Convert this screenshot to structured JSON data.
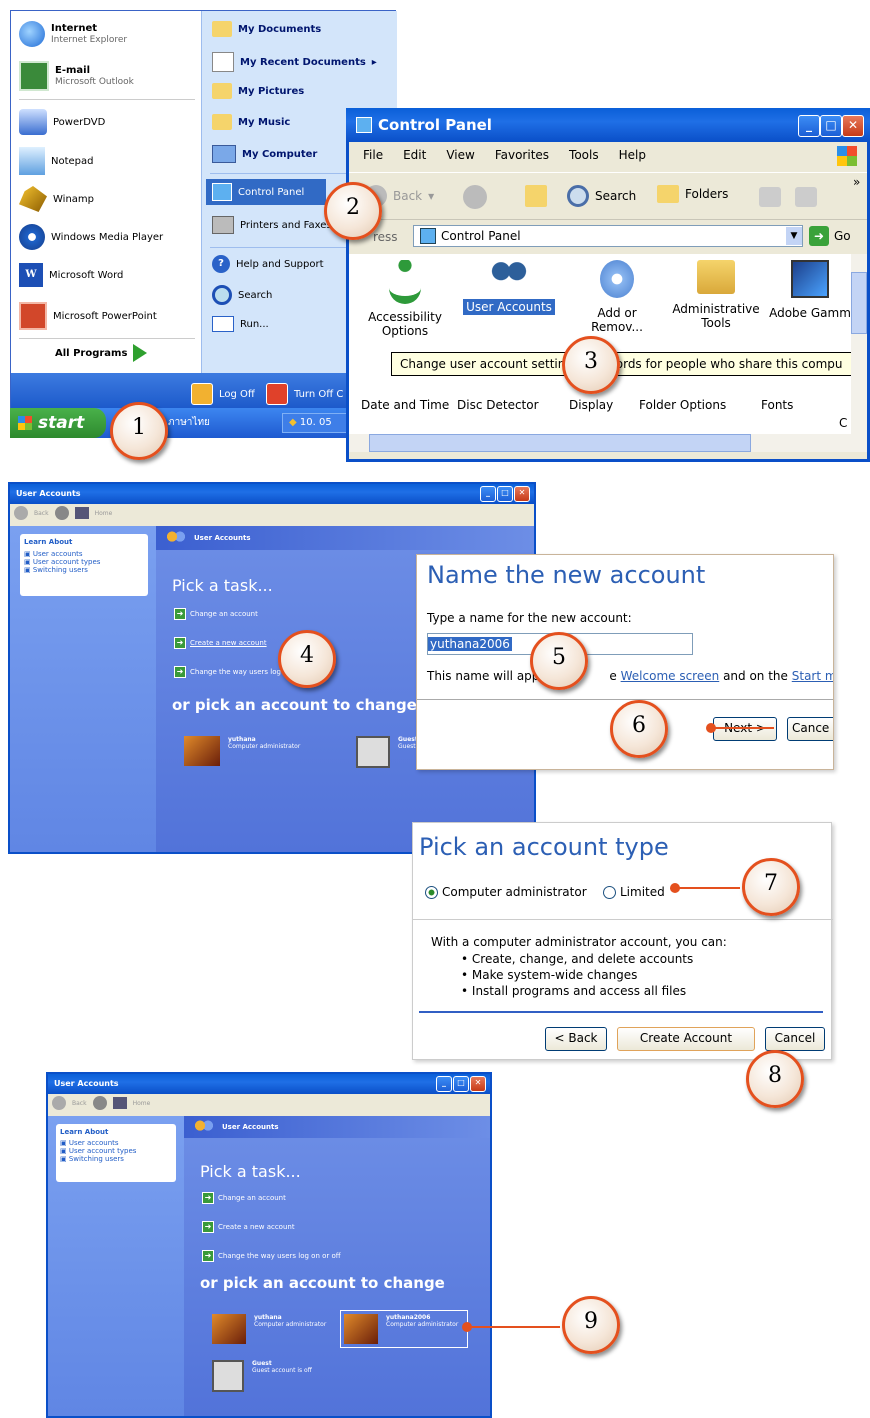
{
  "start_menu": {
    "left_items": [
      {
        "title": "Internet",
        "subtitle": "Internet Explorer",
        "icon": "ie-icon"
      },
      {
        "title": "E-mail",
        "subtitle": "Microsoft Outlook",
        "icon": "outlook-icon"
      },
      {
        "title": "PowerDVD",
        "icon": "powerdvd-icon"
      },
      {
        "title": "Notepad",
        "icon": "notepad-icon"
      },
      {
        "title": "Winamp",
        "icon": "winamp-icon"
      },
      {
        "title": "Windows Media Player",
        "icon": "wmp-icon"
      },
      {
        "title": "Microsoft Word",
        "icon": "word-icon"
      },
      {
        "title": "Microsoft PowerPoint",
        "icon": "powerpoint-icon"
      }
    ],
    "all_programs": "All Programs",
    "right_items": [
      "My Documents",
      "My Recent Documents",
      "My Pictures",
      "My Music",
      "My Computer",
      "Control Panel",
      "Printers and Faxes",
      "Help and Support",
      "Search",
      "Run..."
    ],
    "log_off": "Log Off",
    "turn_off": "Turn Off C",
    "start_label": "start",
    "taskbar_item": "ภาษาไทย",
    "taskbar_item2": "10. 05"
  },
  "control_panel": {
    "title": "Control Panel",
    "menu": [
      "File",
      "Edit",
      "View",
      "Favorites",
      "Tools",
      "Help"
    ],
    "back": "Back",
    "search": "Search",
    "folders": "Folders",
    "address_label": "ress",
    "address_value": "Control Panel",
    "go": "Go",
    "icons_row1": [
      {
        "label": "Accessibility Options",
        "icon": "accessibility-icon"
      },
      {
        "label": "User Accounts",
        "icon": "user-accounts-icon"
      },
      {
        "label": "Add or Remov...",
        "icon": "add-remove-icon"
      },
      {
        "label": "Administrative Tools",
        "icon": "admin-tools-icon"
      },
      {
        "label": "Adobe Gamm",
        "icon": "adobe-gamma-icon"
      }
    ],
    "tooltip": "Change user account settin         swords for people who share this compu",
    "icons_row2": [
      "Date and Time",
      "Disc Detector",
      "Display",
      "Folder Options",
      "Fonts"
    ],
    "scroll_frag": "C"
  },
  "ua_window": {
    "title": "User Accounts",
    "back": "Back",
    "home": "Home",
    "learn_about": "Learn About",
    "learn_items": [
      "User accounts",
      "User account types",
      "Switching users"
    ],
    "header": "User Accounts",
    "pick_task": "Pick a task...",
    "tasks": [
      "Change an account",
      "Create a new account",
      "Change the way users log on or off"
    ],
    "pick_account": "or pick an account to change",
    "accounts": [
      {
        "name": "yuthana",
        "role": "Computer administrator"
      },
      {
        "name": "Guest",
        "role": "Guest account is off"
      },
      {
        "name": "yuthana2006",
        "role": "Computer administrator"
      }
    ]
  },
  "name_dialog": {
    "heading": "Name the new account",
    "prompt": "Type a name for the new account:",
    "input_value": "yuthana2006",
    "note_start": "This name will app",
    "note_link1": "Welcome screen",
    "note_mid": "and on the",
    "note_link2": "Start menu",
    "note_frag": "e",
    "next": "Next >",
    "cancel": "Cance"
  },
  "type_dialog": {
    "heading": "Pick an account type",
    "option_admin": "Computer administrator",
    "option_limited": "Limited",
    "description": "With a computer administrator account, you can:",
    "bullets": [
      "Create, change, and delete accounts",
      "Make system-wide changes",
      "Install programs and access all files"
    ],
    "back": "< Back",
    "create": "Create Account",
    "cancel": "Cancel"
  },
  "steps": [
    "1",
    "2",
    "3",
    "4",
    "5",
    "6",
    "7",
    "8",
    "9"
  ],
  "colors": {
    "callout_border": "#e4501e",
    "xp_blue": "#0a5fd8",
    "ua_blue": "#5a7ddc"
  }
}
